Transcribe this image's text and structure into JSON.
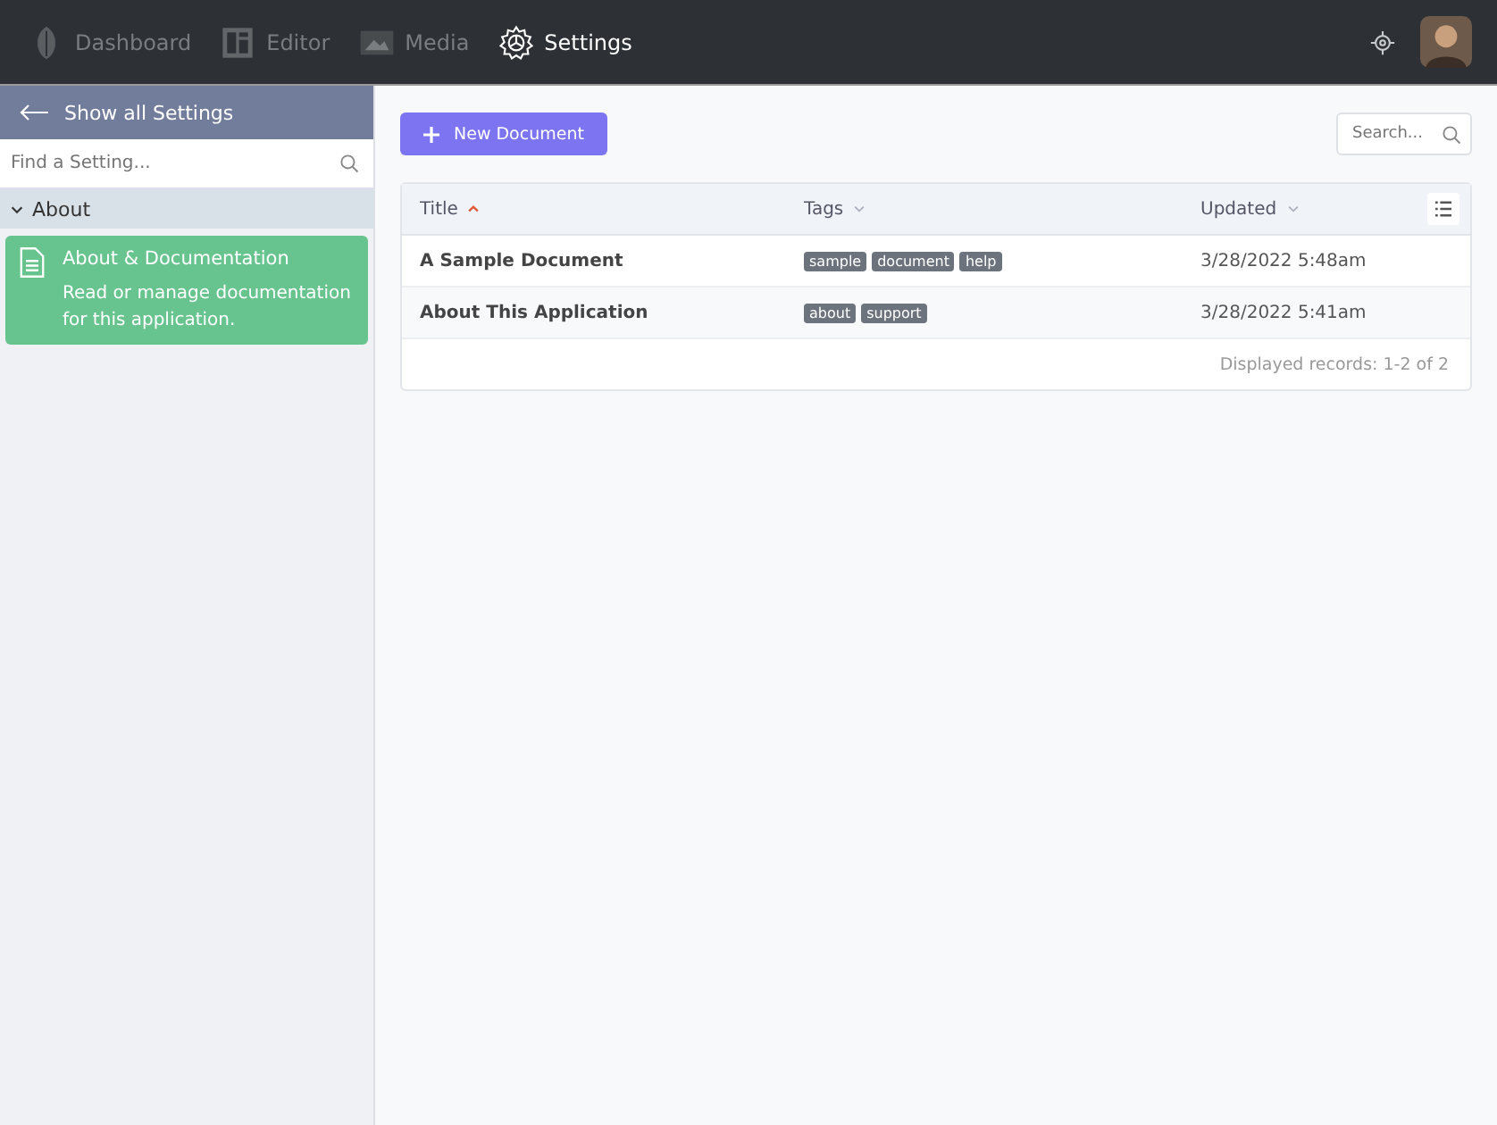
{
  "nav": [
    {
      "label": "Dashboard",
      "kind": "leaf",
      "selected": false
    },
    {
      "label": "Editor",
      "kind": "newspaper",
      "selected": false
    },
    {
      "label": "Media",
      "kind": "image",
      "selected": false
    },
    {
      "label": "Settings",
      "kind": "gear",
      "selected": true
    }
  ],
  "sidebar": {
    "back": "Show all Settings",
    "search": {
      "placeholder": "Find a Setting..."
    },
    "groups": [
      {
        "label": "About",
        "expanded": true,
        "items": [
          {
            "title": "About & Documentation",
            "description": "Read or manage documentation for this application.",
            "selected": true
          }
        ]
      }
    ]
  },
  "toolbar": {
    "new_button": "New Document",
    "search": {
      "placeholder": "Search..."
    }
  },
  "table": {
    "columns": [
      {
        "label": "Title",
        "sorted": true
      },
      {
        "label": "Tags",
        "sorted": false
      },
      {
        "label": "Updated",
        "sorted": false
      }
    ],
    "rows": [
      {
        "title": "A Sample Document",
        "tags": [
          "sample",
          "document",
          "help"
        ],
        "updated": "3/28/2022 5:48am"
      },
      {
        "title": "About This Application",
        "tags": [
          "about",
          "support"
        ],
        "updated": "3/28/2022 5:41am"
      }
    ],
    "footer": "Displayed records: 1-2 of 2"
  }
}
